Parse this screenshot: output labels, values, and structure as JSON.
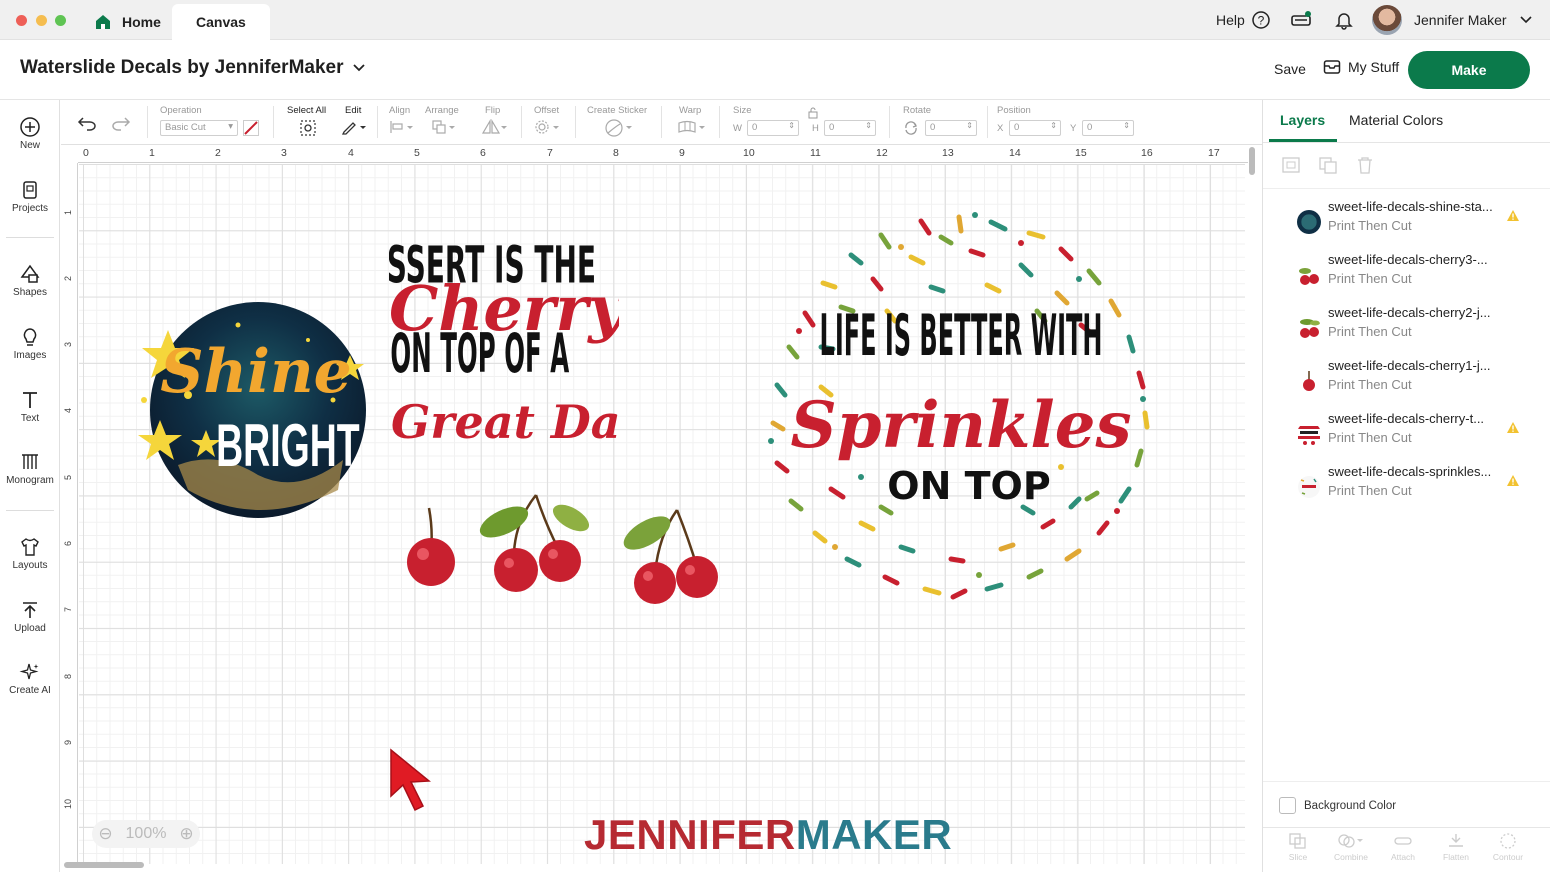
{
  "window": {
    "tabs": [
      {
        "label": "Home"
      },
      {
        "label": "Canvas"
      }
    ],
    "help_label": "Help",
    "user_name": "Jennifer Maker"
  },
  "project": {
    "title": "Waterslide Decals by JenniferMaker",
    "save_label": "Save",
    "mystuff_label": "My Stuff",
    "make_label": "Make"
  },
  "left_rail": [
    {
      "label": "New",
      "icon": "plus-circle-icon"
    },
    {
      "label": "Projects",
      "icon": "projects-icon"
    },
    {
      "label": "Shapes",
      "icon": "shapes-icon"
    },
    {
      "label": "Images",
      "icon": "lightbulb-icon"
    },
    {
      "label": "Text",
      "icon": "text-icon"
    },
    {
      "label": "Monogram",
      "icon": "monogram-icon"
    },
    {
      "label": "Layouts",
      "icon": "shirt-icon"
    },
    {
      "label": "Upload",
      "icon": "upload-icon"
    },
    {
      "label": "Create AI",
      "icon": "sparkle-icon"
    }
  ],
  "toolbar": {
    "operation_label": "Operation",
    "operation_value": "Basic Cut",
    "select_all_label": "Select All",
    "edit_label": "Edit",
    "align_label": "Align",
    "arrange_label": "Arrange",
    "flip_label": "Flip",
    "offset_label": "Offset",
    "create_sticker_label": "Create Sticker",
    "warp_label": "Warp",
    "size_label": "Size",
    "w_label": "W",
    "w_value": "0",
    "h_label": "H",
    "h_value": "0",
    "rotate_label": "Rotate",
    "rotate_value": "0",
    "position_label": "Position",
    "x_label": "X",
    "x_value": "0",
    "y_label": "Y",
    "y_value": "0"
  },
  "canvas": {
    "ruler_top": [
      "0",
      "1",
      "2",
      "3",
      "4",
      "5",
      "6",
      "7",
      "8",
      "9",
      "10",
      "11",
      "12",
      "13",
      "14",
      "15",
      "16",
      "17"
    ],
    "ruler_left": [
      "1",
      "2",
      "3",
      "4",
      "5",
      "6",
      "7",
      "8",
      "9",
      "10"
    ],
    "zoom_value": "100%",
    "watermark_part1": "JENNIFER",
    "watermark_part2": "MAKER",
    "shine": {
      "word1": "Shine",
      "word2": "BRIGHT"
    },
    "dessert": {
      "line1": "DESSERT IS THE",
      "line2": "Cherry",
      "line3": "ON TOP OF A",
      "line4": "Great Day"
    },
    "sprinkles": {
      "line1": "LIFE IS BETTER WITH",
      "line2": "Sprinkles",
      "line3": "ON TOP"
    }
  },
  "right_panel": {
    "tabs": [
      {
        "label": "Layers"
      },
      {
        "label": "Material Colors"
      }
    ],
    "layers": [
      {
        "name": "sweet-life-decals-shine-sta...",
        "op": "Print Then Cut",
        "warning": true
      },
      {
        "name": "sweet-life-decals-cherry3-...",
        "op": "Print Then Cut",
        "warning": false
      },
      {
        "name": "sweet-life-decals-cherry2-j...",
        "op": "Print Then Cut",
        "warning": false
      },
      {
        "name": "sweet-life-decals-cherry1-j...",
        "op": "Print Then Cut",
        "warning": false
      },
      {
        "name": "sweet-life-decals-cherry-t...",
        "op": "Print Then Cut",
        "warning": true
      },
      {
        "name": "sweet-life-decals-sprinkles...",
        "op": "Print Then Cut",
        "warning": true
      }
    ],
    "background_color_label": "Background Color",
    "bottom_tools": [
      {
        "label": "Slice"
      },
      {
        "label": "Combine"
      },
      {
        "label": "Attach"
      },
      {
        "label": "Flatten"
      },
      {
        "label": "Contour"
      }
    ]
  },
  "colors": {
    "accent_green": "#0b7a4b",
    "cherry_red": "#c8202f",
    "watermark_teal": "#2a7b8c",
    "warning_yellow": "#f2c230"
  }
}
